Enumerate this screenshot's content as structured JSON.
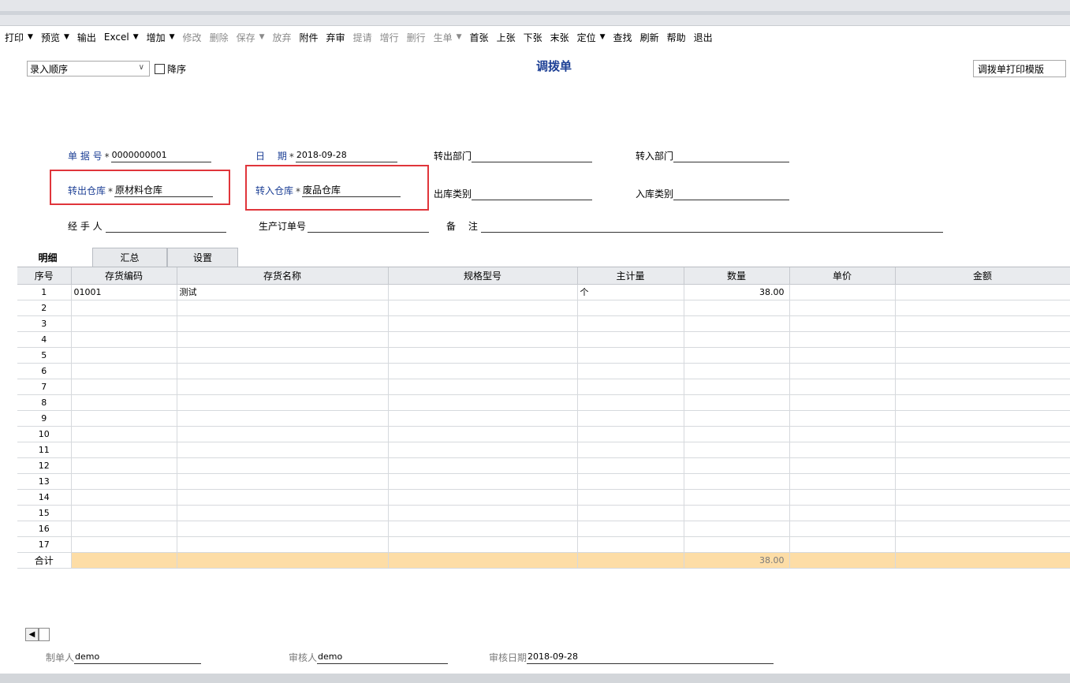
{
  "toolbar": [
    {
      "label": "打印",
      "arrow": true,
      "disabled": false
    },
    {
      "label": "预览",
      "arrow": true,
      "disabled": false
    },
    {
      "label": "输出",
      "arrow": false,
      "disabled": false
    },
    {
      "label": "Excel",
      "arrow": true,
      "disabled": false
    },
    {
      "label": "增加",
      "arrow": true,
      "disabled": false
    },
    {
      "label": "修改",
      "arrow": false,
      "disabled": true
    },
    {
      "label": "删除",
      "arrow": false,
      "disabled": true
    },
    {
      "label": "保存",
      "arrow": true,
      "disabled": true
    },
    {
      "label": "放弃",
      "arrow": false,
      "disabled": true
    },
    {
      "label": "附件",
      "arrow": false,
      "disabled": false
    },
    {
      "label": "弃审",
      "arrow": false,
      "disabled": false
    },
    {
      "label": "提请",
      "arrow": false,
      "disabled": true
    },
    {
      "label": "增行",
      "arrow": false,
      "disabled": true
    },
    {
      "label": "删行",
      "arrow": false,
      "disabled": true
    },
    {
      "label": "生单",
      "arrow": true,
      "disabled": true
    },
    {
      "label": "首张",
      "arrow": false,
      "disabled": false
    },
    {
      "label": "上张",
      "arrow": false,
      "disabled": false
    },
    {
      "label": "下张",
      "arrow": false,
      "disabled": false
    },
    {
      "label": "末张",
      "arrow": false,
      "disabled": false
    },
    {
      "label": "定位",
      "arrow": true,
      "disabled": false
    },
    {
      "label": "查找",
      "arrow": false,
      "disabled": false
    },
    {
      "label": "刷新",
      "arrow": false,
      "disabled": false
    },
    {
      "label": "帮助",
      "arrow": false,
      "disabled": false
    },
    {
      "label": "退出",
      "arrow": false,
      "disabled": false
    }
  ],
  "sort": {
    "value": "录入顺序",
    "desc_label": "降序"
  },
  "title": "调拨单",
  "template": "调拨单打印模版",
  "header": {
    "doc_no": {
      "label": "单 据 号",
      "value": "0000000001"
    },
    "date": {
      "label": "日　 期",
      "value": "2018-09-28"
    },
    "out_dept": {
      "label": "转出部门",
      "value": ""
    },
    "in_dept": {
      "label": "转入部门",
      "value": ""
    },
    "out_wh": {
      "label": "转出仓库",
      "value": "原材料仓库"
    },
    "in_wh": {
      "label": "转入仓库",
      "value": "废品仓库"
    },
    "out_type": {
      "label": "出库类别",
      "value": ""
    },
    "in_type": {
      "label": "入库类别",
      "value": ""
    },
    "handler": {
      "label": "经 手 人",
      "value": ""
    },
    "prod_order": {
      "label": "生产订单号",
      "value": ""
    },
    "remark": {
      "label": "备　 注",
      "value": ""
    },
    "required_mark": "*"
  },
  "tabs": [
    "明细",
    "汇总",
    "设置"
  ],
  "columns": [
    "序号",
    "存货编码",
    "存货名称",
    "规格型号",
    "主计量",
    "数量",
    "单价",
    "金额"
  ],
  "rows": [
    {
      "idx": "1",
      "code": "01001",
      "name": "测试",
      "spec": "",
      "unit": "个",
      "qty": "38.00",
      "price": "",
      "amount": ""
    },
    {
      "idx": "2",
      "code": "",
      "name": "",
      "spec": "",
      "unit": "",
      "qty": "",
      "price": "",
      "amount": ""
    },
    {
      "idx": "3",
      "code": "",
      "name": "",
      "spec": "",
      "unit": "",
      "qty": "",
      "price": "",
      "amount": ""
    },
    {
      "idx": "4",
      "code": "",
      "name": "",
      "spec": "",
      "unit": "",
      "qty": "",
      "price": "",
      "amount": ""
    },
    {
      "idx": "5",
      "code": "",
      "name": "",
      "spec": "",
      "unit": "",
      "qty": "",
      "price": "",
      "amount": ""
    },
    {
      "idx": "6",
      "code": "",
      "name": "",
      "spec": "",
      "unit": "",
      "qty": "",
      "price": "",
      "amount": ""
    },
    {
      "idx": "7",
      "code": "",
      "name": "",
      "spec": "",
      "unit": "",
      "qty": "",
      "price": "",
      "amount": ""
    },
    {
      "idx": "8",
      "code": "",
      "name": "",
      "spec": "",
      "unit": "",
      "qty": "",
      "price": "",
      "amount": ""
    },
    {
      "idx": "9",
      "code": "",
      "name": "",
      "spec": "",
      "unit": "",
      "qty": "",
      "price": "",
      "amount": ""
    },
    {
      "idx": "10",
      "code": "",
      "name": "",
      "spec": "",
      "unit": "",
      "qty": "",
      "price": "",
      "amount": ""
    },
    {
      "idx": "11",
      "code": "",
      "name": "",
      "spec": "",
      "unit": "",
      "qty": "",
      "price": "",
      "amount": ""
    },
    {
      "idx": "12",
      "code": "",
      "name": "",
      "spec": "",
      "unit": "",
      "qty": "",
      "price": "",
      "amount": ""
    },
    {
      "idx": "13",
      "code": "",
      "name": "",
      "spec": "",
      "unit": "",
      "qty": "",
      "price": "",
      "amount": ""
    },
    {
      "idx": "14",
      "code": "",
      "name": "",
      "spec": "",
      "unit": "",
      "qty": "",
      "price": "",
      "amount": ""
    },
    {
      "idx": "15",
      "code": "",
      "name": "",
      "spec": "",
      "unit": "",
      "qty": "",
      "price": "",
      "amount": ""
    },
    {
      "idx": "16",
      "code": "",
      "name": "",
      "spec": "",
      "unit": "",
      "qty": "",
      "price": "",
      "amount": ""
    },
    {
      "idx": "17",
      "code": "",
      "name": "",
      "spec": "",
      "unit": "",
      "qty": "",
      "price": "",
      "amount": ""
    }
  ],
  "total": {
    "label": "合计",
    "qty": "38.00"
  },
  "footer": {
    "maker": {
      "label": "制单人",
      "value": "demo"
    },
    "auditor": {
      "label": "审核人",
      "value": "demo"
    },
    "audit_date": {
      "label": "审核日期",
      "value": "2018-09-28"
    }
  },
  "colors": {
    "highlight": "#e0353b",
    "title": "#1c3f95",
    "total_row": "#fddda6"
  }
}
